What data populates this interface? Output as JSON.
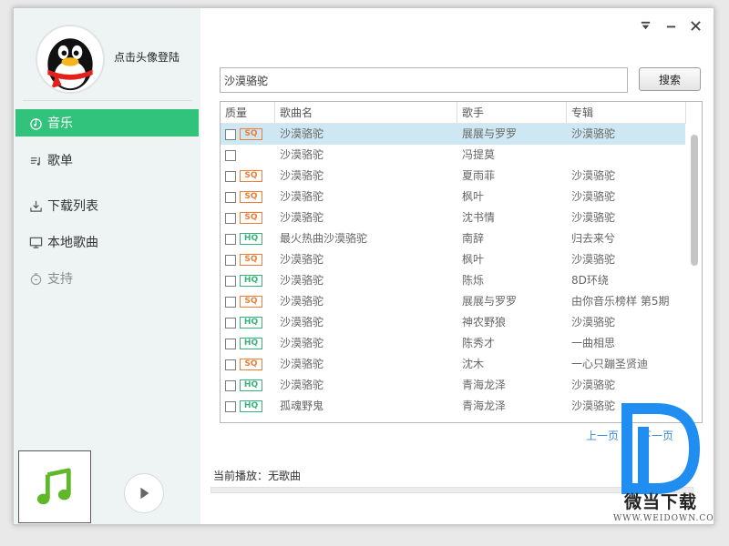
{
  "user": {
    "login_text": "点击头像登陆"
  },
  "sidebar": {
    "items": [
      {
        "label": "音乐",
        "icon": "music-note-icon"
      },
      {
        "label": "歌单",
        "icon": "playlist-icon"
      },
      {
        "label": "下载列表",
        "icon": "download-icon"
      },
      {
        "label": "本地歌曲",
        "icon": "monitor-icon"
      },
      {
        "label": "支持",
        "icon": "support-icon"
      }
    ],
    "active": "音乐"
  },
  "search": {
    "value": "沙漠骆驼",
    "button_label": "搜索"
  },
  "table": {
    "columns": [
      "质量",
      "歌曲名",
      "歌手",
      "专辑"
    ],
    "rows": [
      {
        "quality": "SQ",
        "title": "沙漠骆驼",
        "artist": "展展与罗罗",
        "album": "沙漠骆驼"
      },
      {
        "quality": "",
        "title": "沙漠骆驼",
        "artist": "冯提莫",
        "album": ""
      },
      {
        "quality": "SQ",
        "title": "沙漠骆驼",
        "artist": "夏雨菲",
        "album": "沙漠骆驼"
      },
      {
        "quality": "SQ",
        "title": "沙漠骆驼",
        "artist": "枫叶",
        "album": "沙漠骆驼"
      },
      {
        "quality": "SQ",
        "title": "沙漠骆驼",
        "artist": "沈书情",
        "album": "沙漠骆驼"
      },
      {
        "quality": "HQ",
        "title": "最火热曲沙漠骆驼",
        "artist": "南辞",
        "album": "归去来兮"
      },
      {
        "quality": "SQ",
        "title": "沙漠骆驼",
        "artist": "枫叶",
        "album": "沙漠骆驼"
      },
      {
        "quality": "HQ",
        "title": "沙漠骆驼",
        "artist": "陈烁",
        "album": "8D环绕"
      },
      {
        "quality": "SQ",
        "title": "沙漠骆驼",
        "artist": "展展与罗罗",
        "album": "由你音乐榜样 第5期"
      },
      {
        "quality": "HQ",
        "title": "沙漠骆驼",
        "artist": "神农野狼",
        "album": "沙漠骆驼"
      },
      {
        "quality": "HQ",
        "title": "沙漠骆驼",
        "artist": "陈秀才",
        "album": "一曲相思"
      },
      {
        "quality": "SQ",
        "title": "沙漠骆驼",
        "artist": "沈木",
        "album": "一心只蹦圣贤迪"
      },
      {
        "quality": "HQ",
        "title": "沙漠骆驼",
        "artist": "青海龙泽",
        "album": "沙漠骆驼"
      },
      {
        "quality": "HQ",
        "title": "孤魂野鬼",
        "artist": "青海龙泽",
        "album": "沙漠骆驼"
      }
    ]
  },
  "pager": {
    "prev": "上一页",
    "next": "下一页"
  },
  "player": {
    "now_playing": "当前播放：无歌曲"
  },
  "watermark": {
    "name": "微当下载",
    "url": "WWW.WEIDOWN.COM"
  },
  "colors": {
    "accent": "#31c27c",
    "sq": "#ee7d36",
    "hq": "#37b37a",
    "selected_row": "#cde8f3",
    "link": "#3a8bd8"
  }
}
